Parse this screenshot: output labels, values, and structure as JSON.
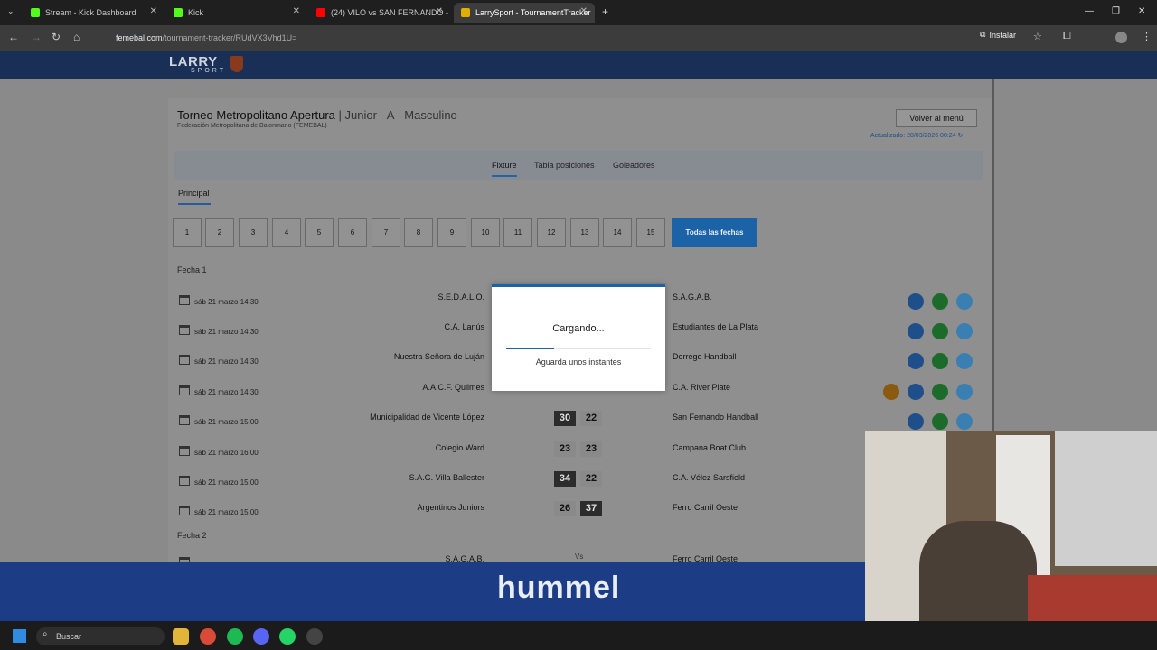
{
  "browser": {
    "tabs": [
      {
        "label": "Stream - Kick Dashboard",
        "fav": "#53fc18"
      },
      {
        "label": "Kick",
        "fav": "#53fc18"
      },
      {
        "label": "(24) VILO vs SAN FERNANDO -",
        "fav": "#ff0000"
      },
      {
        "label": "LarrySport - TournamentTracker",
        "fav": "#e0b000"
      }
    ],
    "url_domain": "femebal.com",
    "url_path": "/tournament-tracker/RUdVX3Vhd1U=",
    "install_label": "Instalar"
  },
  "header": {
    "logo": "LARRY",
    "logo_sub": "SPORT"
  },
  "tournament": {
    "title": "Torneo Metropolitano Apertura",
    "category": "| Junior - A - Masculino",
    "federation": "Federación Metropolitana de Balonmano (FEMEBAL)",
    "back_label": "Volver al menú",
    "updated": "Actualizado: 28/03/2026 00:24"
  },
  "tabs": [
    "Fixture",
    "Tabla posiciones",
    "Goleadores"
  ],
  "subtab": "Principal",
  "rounds": [
    "1",
    "2",
    "3",
    "4",
    "5",
    "6",
    "7",
    "8",
    "9",
    "10",
    "11",
    "12",
    "13",
    "14",
    "15"
  ],
  "all_rounds": "Todas las fechas",
  "fecha1": "Fecha 1",
  "fecha2": "Fecha 2",
  "matches": [
    {
      "date": "sáb 21 marzo 14:30",
      "home": "S.E.D.A.L.O.",
      "away": "S.A.G.A.B."
    },
    {
      "date": "sáb 21 marzo 14:30",
      "home": "C.A. Lanús",
      "away": "Estudiantes de La Plata"
    },
    {
      "date": "sáb 21 marzo 14:30",
      "home": "Nuestra Señora de Luján",
      "away": "Dorrego Handball"
    },
    {
      "date": "sáb 21 marzo 14:30",
      "home": "A.A.C.F. Quilmes",
      "away": "C.A. River Plate"
    },
    {
      "date": "sáb 21 marzo 15:00",
      "home": "Municipalidad de Vicente López",
      "away": "San Fernando Handball",
      "hs": "30",
      "as": "22",
      "win": "home"
    },
    {
      "date": "sáb 21 marzo 16:00",
      "home": "Colegio Ward",
      "away": "Campana Boat Club",
      "hs": "23",
      "as": "23",
      "win": ""
    },
    {
      "date": "sáb 21 marzo 15:00",
      "home": "S.A.G. Villa Ballester",
      "away": "C.A. Vélez Sarsfield",
      "hs": "34",
      "as": "22",
      "win": "home"
    },
    {
      "date": "sáb 21 marzo 15:00",
      "home": "Argentinos Juniors",
      "away": "Ferro Carril Oeste",
      "hs": "26",
      "as": "37",
      "win": "away"
    }
  ],
  "next_match": {
    "home": "S.A.G.A.B.",
    "vs": "Vs",
    "away": "Ferro Carril Oeste"
  },
  "modal": {
    "title": "Cargando...",
    "message": "Aguarda unos instantes",
    "progress": 0.33
  },
  "sponsor": "hummel",
  "taskbar": {
    "search": "Buscar"
  }
}
